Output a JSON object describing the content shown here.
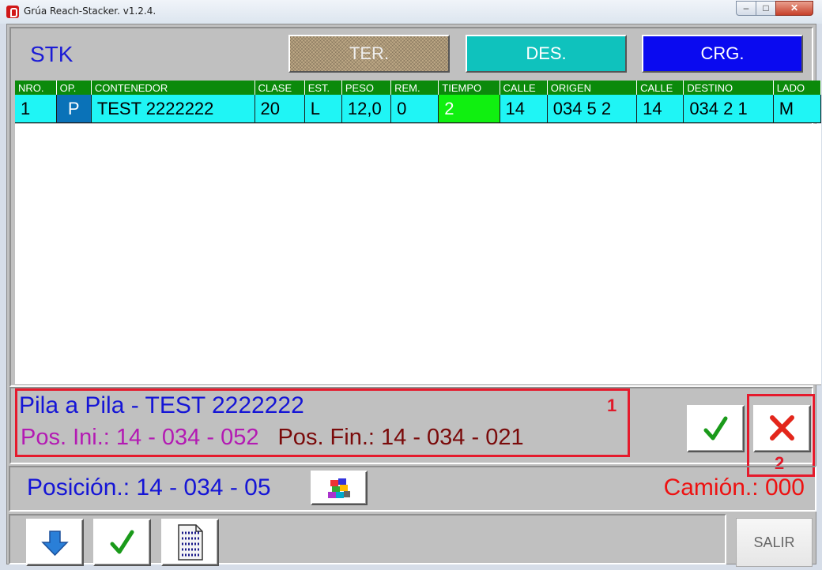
{
  "window": {
    "title": "Grúa Reach-Stacker. v1.2.4.",
    "controls": [
      "minimize",
      "maximize",
      "close"
    ]
  },
  "header": {
    "label": "STK",
    "buttons": [
      {
        "label": "TER.",
        "color": "#bfa986"
      },
      {
        "label": "DES.",
        "color": "#0fc2bd"
      },
      {
        "label": "CRG.",
        "color": "#0a0af0"
      }
    ]
  },
  "grid": {
    "columns": [
      "NRO.",
      "OP.",
      "CONTENEDOR",
      "CLASE",
      "EST.",
      "PESO",
      "REM.",
      "TIEMPO",
      "CALLE",
      "ORIGEN",
      "CALLE",
      "DESTINO",
      "LADO"
    ],
    "rows": [
      [
        "1",
        "P",
        "TEST 2222222",
        "20",
        "L",
        "12,0",
        "0",
        "2",
        "14",
        "034 5 2",
        "14",
        "034 2 1",
        "M"
      ]
    ],
    "header_color": "#0b8a0b",
    "row_color": "#1ff5f5"
  },
  "info": {
    "line1": "Pila a Pila - TEST 2222222",
    "pos_ini": "Pos. Ini.: 14 - 034 - 052",
    "pos_fin": "Pos. Fin.: 14 - 034 - 021",
    "marker1": "1",
    "marker2": "2"
  },
  "actions": {
    "confirm_icon": "checkmark-icon",
    "cancel_icon": "red-x-icon"
  },
  "position": {
    "text": "Posición.: 14 - 034 - 05",
    "button_icon": "container-stack-icon",
    "camion": "Camión.: 000"
  },
  "toolbar": {
    "buttons": [
      "down-arrow-icon",
      "checkmark-icon",
      "binary-document-icon"
    ],
    "salir": "SALIR"
  }
}
